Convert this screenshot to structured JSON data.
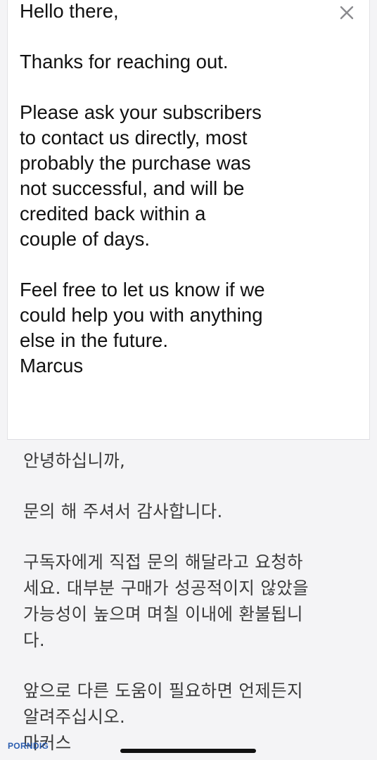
{
  "email": {
    "greeting": "Hello there,",
    "thanks": "Thanks for reaching out.",
    "body_lines": [
      "Please ask your subscribers",
      "to contact us directly, most",
      "probably the purchase was",
      "not successful, and will be",
      "credited back within a",
      "couple of days."
    ],
    "closing_lines": [
      "Feel free to let us know if we",
      "could help you with anything",
      "else in the future."
    ],
    "signature": "Marcus"
  },
  "translation": {
    "greeting": "안녕하십니까,",
    "thanks": "문의 해 주셔서 감사합니다.",
    "body_lines": [
      "구독자에게 직접 문의 해달라고 요청하",
      "세요. 대부분 구매가 성공적이지 않았을",
      "가능성이 높으며 며칠 이내에 환불됩니",
      "다."
    ],
    "closing_lines": [
      "앞으로 다른 도움이 필요하면 언제든지",
      "알려주십시오."
    ],
    "signature": "마커스"
  },
  "watermark": {
    "part1": "PORN",
    "part2": "DIG"
  },
  "icons": {
    "close": "close-icon"
  },
  "colors": {
    "card_background": "#ffffff",
    "page_background": "#f4f4f6",
    "text_primary": "#111111",
    "text_translation": "#3a3a3a"
  }
}
